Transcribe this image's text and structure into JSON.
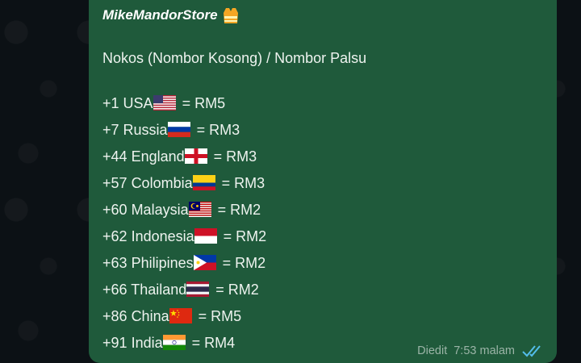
{
  "message": {
    "sender": "MikeMandorStore",
    "sender_icon": "safety-vest-icon",
    "subtitle": "Nokos (Nombor Kosong) / Nombor Palsu",
    "rates": [
      {
        "code": "+1",
        "country": "USA",
        "flag": "flag-usa-icon",
        "price": "= RM5"
      },
      {
        "code": "+7",
        "country": "Russia",
        "flag": "flag-russia-icon",
        "price": "= RM3"
      },
      {
        "code": "+44",
        "country": "England",
        "flag": "flag-england-icon",
        "price": "= RM3"
      },
      {
        "code": "+57",
        "country": "Colombia",
        "flag": "flag-colombia-icon",
        "price": "= RM3"
      },
      {
        "code": "+60",
        "country": "Malaysia",
        "flag": "flag-malaysia-icon",
        "price": "= RM2"
      },
      {
        "code": "+62",
        "country": "Indonesia",
        "flag": "flag-indonesia-icon",
        "price": "= RM2"
      },
      {
        "code": "+63",
        "country": "Philipines",
        "flag": "flag-philippines-icon",
        "price": "= RM2"
      },
      {
        "code": "+66",
        "country": "Thailand",
        "flag": "flag-thailand-icon",
        "price": "= RM2"
      },
      {
        "code": "+86",
        "country": "China",
        "flag": "flag-china-icon",
        "price": "= RM5"
      },
      {
        "code": "+91",
        "country": "India",
        "flag": "flag-india-icon",
        "price": "= RM4"
      }
    ],
    "edited_label": "Diedit",
    "time": "7:53 malam",
    "status_icon": "double-check-read-icon"
  },
  "colors": {
    "bubble": "#1f5a3b",
    "read_ticks": "#53bdeb",
    "meta_text": "#9bb4a7"
  }
}
